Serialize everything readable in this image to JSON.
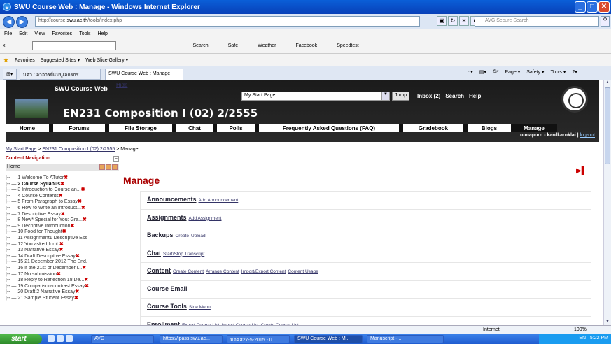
{
  "window": {
    "title": "SWU Course Web : Manage - Windows Internet Explorer",
    "icon": "ie-icon"
  },
  "address": {
    "url_prefix": "http://course.",
    "url_host": "swu.ac.th",
    "url_path": "/tools/index.php",
    "search_placeholder": "AVG Secure Search"
  },
  "menu": [
    "File",
    "Edit",
    "View",
    "Favorites",
    "Tools",
    "Help"
  ],
  "linkbar": {
    "close": "x",
    "search": "Search",
    "safe": "Safe",
    "weather": "Weather",
    "facebook": "Facebook",
    "speedtest": "Speedtest"
  },
  "favorites": {
    "label": "Favorites",
    "suggested": "Suggested Sites ▾",
    "webslice": "Web Slice Gallery ▾"
  },
  "tabs": [
    {
      "label": "มศว : อาจารย์แมนูเอกรกร"
    },
    {
      "label": "SWU Course Web : Manage"
    }
  ],
  "tab_tools": {
    "page": "Page ▾",
    "safety": "Safety ▾",
    "tools": "Tools ▾"
  },
  "header": {
    "site": "SWU Course Web",
    "course": "EN231 Composition I (02) 2/2555",
    "jump_value": "My Start Page",
    "jump": "Jump",
    "inbox": "Inbox (2)",
    "search": "Search",
    "help": "Help"
  },
  "nav": [
    "Home",
    "Forums",
    "File Storage",
    "Chat",
    "Polls",
    "Frequently Asked Questions (FAQ)",
    "Gradebook",
    "Blogs",
    "Manage"
  ],
  "user": {
    "name": "u-maporn - kardkarnklai",
    "logout": "log-out"
  },
  "breadcrumb": {
    "start": "My Start Page",
    "course": "EN231 Composition I (02) 2/2555",
    "current": "> Manage",
    "sep": ">"
  },
  "sidebar": {
    "title": "Content Navigation",
    "hide": "Hide",
    "home": "Home",
    "items": [
      {
        "t": "1 Welcome To ATutor",
        "x": "✖",
        "b": false
      },
      {
        "t": "2 Course Syllabus",
        "x": "✖",
        "b": true
      },
      {
        "t": "3 Introduction to Course an...",
        "x": "✖",
        "b": false
      },
      {
        "t": "4 Course Contents",
        "x": "✖",
        "b": false
      },
      {
        "t": "5 From Paragraph to Essay",
        "x": "✖",
        "b": false
      },
      {
        "t": "6 How to Write an Introduct...",
        "x": "✖",
        "b": false
      },
      {
        "t": "7 Descriptive Essay",
        "x": "✖",
        "b": false
      },
      {
        "t": "8 New* Special for You: Gra...",
        "x": "✖",
        "b": false
      },
      {
        "t": "9 Decriptive Introcuction",
        "x": "✖",
        "b": false
      },
      {
        "t": "10 Food for Thought",
        "x": "✖",
        "b": false
      },
      {
        "t": "11 Assignment1 Descriptive Ess",
        "x": "",
        "b": false
      },
      {
        "t": "12 You asked for it.",
        "x": "✖",
        "b": false
      },
      {
        "t": "13 Narrative Essay",
        "x": "✖",
        "b": false
      },
      {
        "t": "14 Draft Descriptive Essay",
        "x": "✖",
        "b": false
      },
      {
        "t": "15 21 December 2012 The End.",
        "x": "",
        "b": false
      },
      {
        "t": "16 If the 21st of December i...",
        "x": "✖",
        "b": false
      },
      {
        "t": "17 No submission",
        "x": "✖",
        "b": false
      },
      {
        "t": "18 Reply to Reflection 18 De...",
        "x": "✖",
        "b": false
      },
      {
        "t": "19 Comparison-contrast Essay",
        "x": "✖",
        "b": false
      },
      {
        "t": "20 Draft 2 Narrative Essay",
        "x": "✖",
        "b": false
      },
      {
        "t": "21 Sample Student Essay",
        "x": "✖",
        "b": false
      }
    ]
  },
  "manage": {
    "title": "Manage",
    "rows": [
      {
        "h": "Announcements",
        "links": [
          "Add Announcement"
        ]
      },
      {
        "h": "Assignments",
        "links": [
          "Add Assignment"
        ]
      },
      {
        "h": "Backups",
        "links": [
          "Create",
          "Upload"
        ]
      },
      {
        "h": "Chat",
        "links": [
          "Start/Stop Transcript"
        ]
      },
      {
        "h": "Content",
        "links": [
          "Create Content",
          "Arrange Content",
          "Import/Export Content",
          "Content Usage"
        ]
      },
      {
        "h": "Course Email",
        "links": []
      },
      {
        "h": "Course Tools",
        "links": [
          "Side Menu"
        ]
      },
      {
        "h": "Enrollment",
        "links": [
          "Export Course List",
          "Import Course List",
          "Create Course List"
        ]
      }
    ]
  },
  "status": {
    "zone": "Internet",
    "zoom": "100%"
  },
  "taskbar": {
    "start": "start",
    "items": [
      "AVG",
      "https://ipass.swu.ac...",
      "มอคส27-5-2015 - u...",
      "SWU Course Web : M...",
      "Manuscript - ..."
    ],
    "lang": "EN",
    "time": "5:22 PM"
  }
}
